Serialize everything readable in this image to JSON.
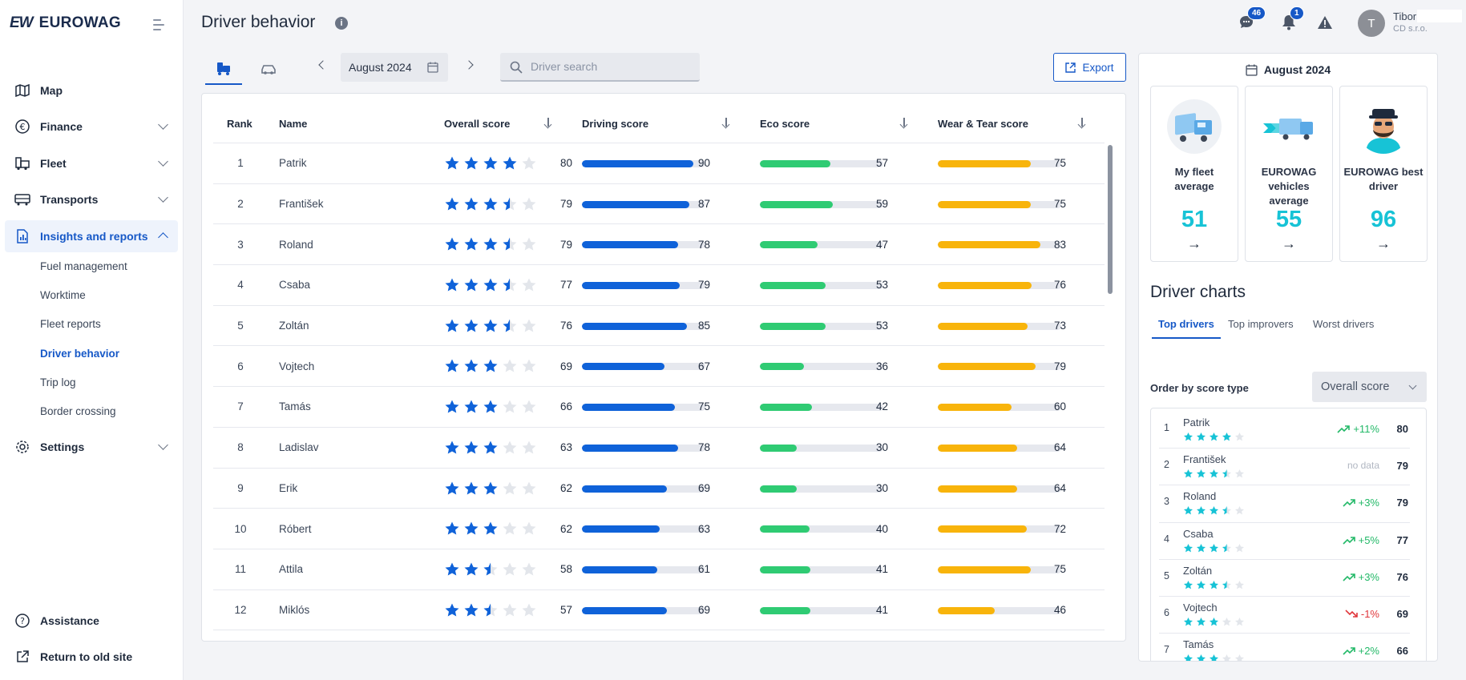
{
  "brand": {
    "mark": "EW",
    "name": "EUROWAG"
  },
  "sidebar": {
    "nav": [
      {
        "label": "Map",
        "icon": "map-icon"
      },
      {
        "label": "Finance",
        "icon": "euro-icon"
      },
      {
        "label": "Fleet",
        "icon": "truck-icon"
      },
      {
        "label": "Transports",
        "icon": "bus-icon"
      },
      {
        "label": "Insights and reports",
        "icon": "chart-report-icon"
      }
    ],
    "sub_items": [
      "Fuel management",
      "Worktime",
      "Fleet reports",
      "Driver behavior",
      "Trip log",
      "Border crossing"
    ],
    "settings": "Settings",
    "assistance": "Assistance",
    "return_old": "Return to old site"
  },
  "header": {
    "title": "Driver behavior",
    "messages_count": "46",
    "notifications_count": "1",
    "user_initial": "T",
    "user_name": "Tibor",
    "user_company": "CD s.r.o."
  },
  "toolbar": {
    "month": "August 2024",
    "search_placeholder": "Driver search",
    "export_label": "Export"
  },
  "table": {
    "columns": [
      "Rank",
      "Name",
      "Overall score",
      "Driving score",
      "Eco score",
      "Wear & Tear score"
    ],
    "rows": [
      {
        "rank": "1",
        "name": "Patrik",
        "stars": 4,
        "overall": "80",
        "driving": 90,
        "driving_label": "90",
        "eco": 57,
        "eco_label": "57",
        "wear": 75,
        "wear_label": "75"
      },
      {
        "rank": "2",
        "name": "František",
        "stars": 3.5,
        "overall": "79",
        "driving": 87,
        "driving_label": "87",
        "eco": 59,
        "eco_label": "59",
        "wear": 75,
        "wear_label": "75"
      },
      {
        "rank": "3",
        "name": "Roland",
        "stars": 3.5,
        "overall": "79",
        "driving": 78,
        "driving_label": "78",
        "eco": 47,
        "eco_label": "47",
        "wear": 83,
        "wear_label": "83"
      },
      {
        "rank": "4",
        "name": "Csaba",
        "stars": 3.5,
        "overall": "77",
        "driving": 79,
        "driving_label": "79",
        "eco": 53,
        "eco_label": "53",
        "wear": 76,
        "wear_label": "76"
      },
      {
        "rank": "5",
        "name": "Zoltán",
        "stars": 3.5,
        "overall": "76",
        "driving": 85,
        "driving_label": "85",
        "eco": 53,
        "eco_label": "53",
        "wear": 73,
        "wear_label": "73"
      },
      {
        "rank": "6",
        "name": "Vojtech",
        "stars": 3,
        "overall": "69",
        "driving": 67,
        "driving_label": "67",
        "eco": 36,
        "eco_label": "36",
        "wear": 79,
        "wear_label": "79"
      },
      {
        "rank": "7",
        "name": "Tamás",
        "stars": 3,
        "overall": "66",
        "driving": 75,
        "driving_label": "75",
        "eco": 42,
        "eco_label": "42",
        "wear": 60,
        "wear_label": "60"
      },
      {
        "rank": "8",
        "name": "Ladislav",
        "stars": 3,
        "overall": "63",
        "driving": 78,
        "driving_label": "78",
        "eco": 30,
        "eco_label": "30",
        "wear": 64,
        "wear_label": "64"
      },
      {
        "rank": "9",
        "name": "Erik",
        "stars": 3,
        "overall": "62",
        "driving": 69,
        "driving_label": "69",
        "eco": 30,
        "eco_label": "30",
        "wear": 64,
        "wear_label": "64"
      },
      {
        "rank": "10",
        "name": "Róbert",
        "stars": 3,
        "overall": "62",
        "driving": 63,
        "driving_label": "63",
        "eco": 40,
        "eco_label": "40",
        "wear": 72,
        "wear_label": "72"
      },
      {
        "rank": "11",
        "name": "Attila",
        "stars": 2.5,
        "overall": "58",
        "driving": 61,
        "driving_label": "61",
        "eco": 41,
        "eco_label": "41",
        "wear": 75,
        "wear_label": "75"
      },
      {
        "rank": "12",
        "name": "Miklós",
        "stars": 2.5,
        "overall": "57",
        "driving": 69,
        "driving_label": "69",
        "eco": 41,
        "eco_label": "41",
        "wear": 46,
        "wear_label": "46"
      }
    ]
  },
  "colors": {
    "driving": "#0f62d9",
    "eco": "#2fcb73",
    "wear": "#f8b40b",
    "star": "#0f62d9",
    "star_empty": "#e3e6eb",
    "accent": "#1658c7",
    "score_accent": "#17c3d6"
  },
  "right_panel": {
    "month": "August 2024",
    "cards": [
      {
        "title": "My fleet average",
        "value": "51",
        "arrow": "→"
      },
      {
        "title": "EUROWAG vehicles average",
        "value": "55",
        "arrow": "→"
      },
      {
        "title": "EUROWAG best driver",
        "value": "96",
        "arrow": "→"
      }
    ],
    "charts_title": "Driver charts",
    "tabs": [
      "Top drivers",
      "Top improvers",
      "Worst drivers"
    ],
    "order_label": "Order by score type",
    "order_value": "Overall score",
    "ranking": [
      {
        "rank": "1",
        "name": "Patrik",
        "stars": 4,
        "trend": "+11%",
        "dir": "up",
        "score": "80"
      },
      {
        "rank": "2",
        "name": "František",
        "stars": 3.5,
        "trend": "no data",
        "dir": "nodata",
        "score": "79"
      },
      {
        "rank": "3",
        "name": "Roland",
        "stars": 3.5,
        "trend": "+3%",
        "dir": "up",
        "score": "79"
      },
      {
        "rank": "4",
        "name": "Csaba",
        "stars": 3.5,
        "trend": "+5%",
        "dir": "up",
        "score": "77"
      },
      {
        "rank": "5",
        "name": "Zoltán",
        "stars": 3.5,
        "trend": "+3%",
        "dir": "up",
        "score": "76"
      },
      {
        "rank": "6",
        "name": "Vojtech",
        "stars": 3,
        "trend": "-1%",
        "dir": "down",
        "score": "69"
      },
      {
        "rank": "7",
        "name": "Tamás",
        "stars": 3,
        "trend": "+2%",
        "dir": "up",
        "score": "66"
      }
    ]
  }
}
